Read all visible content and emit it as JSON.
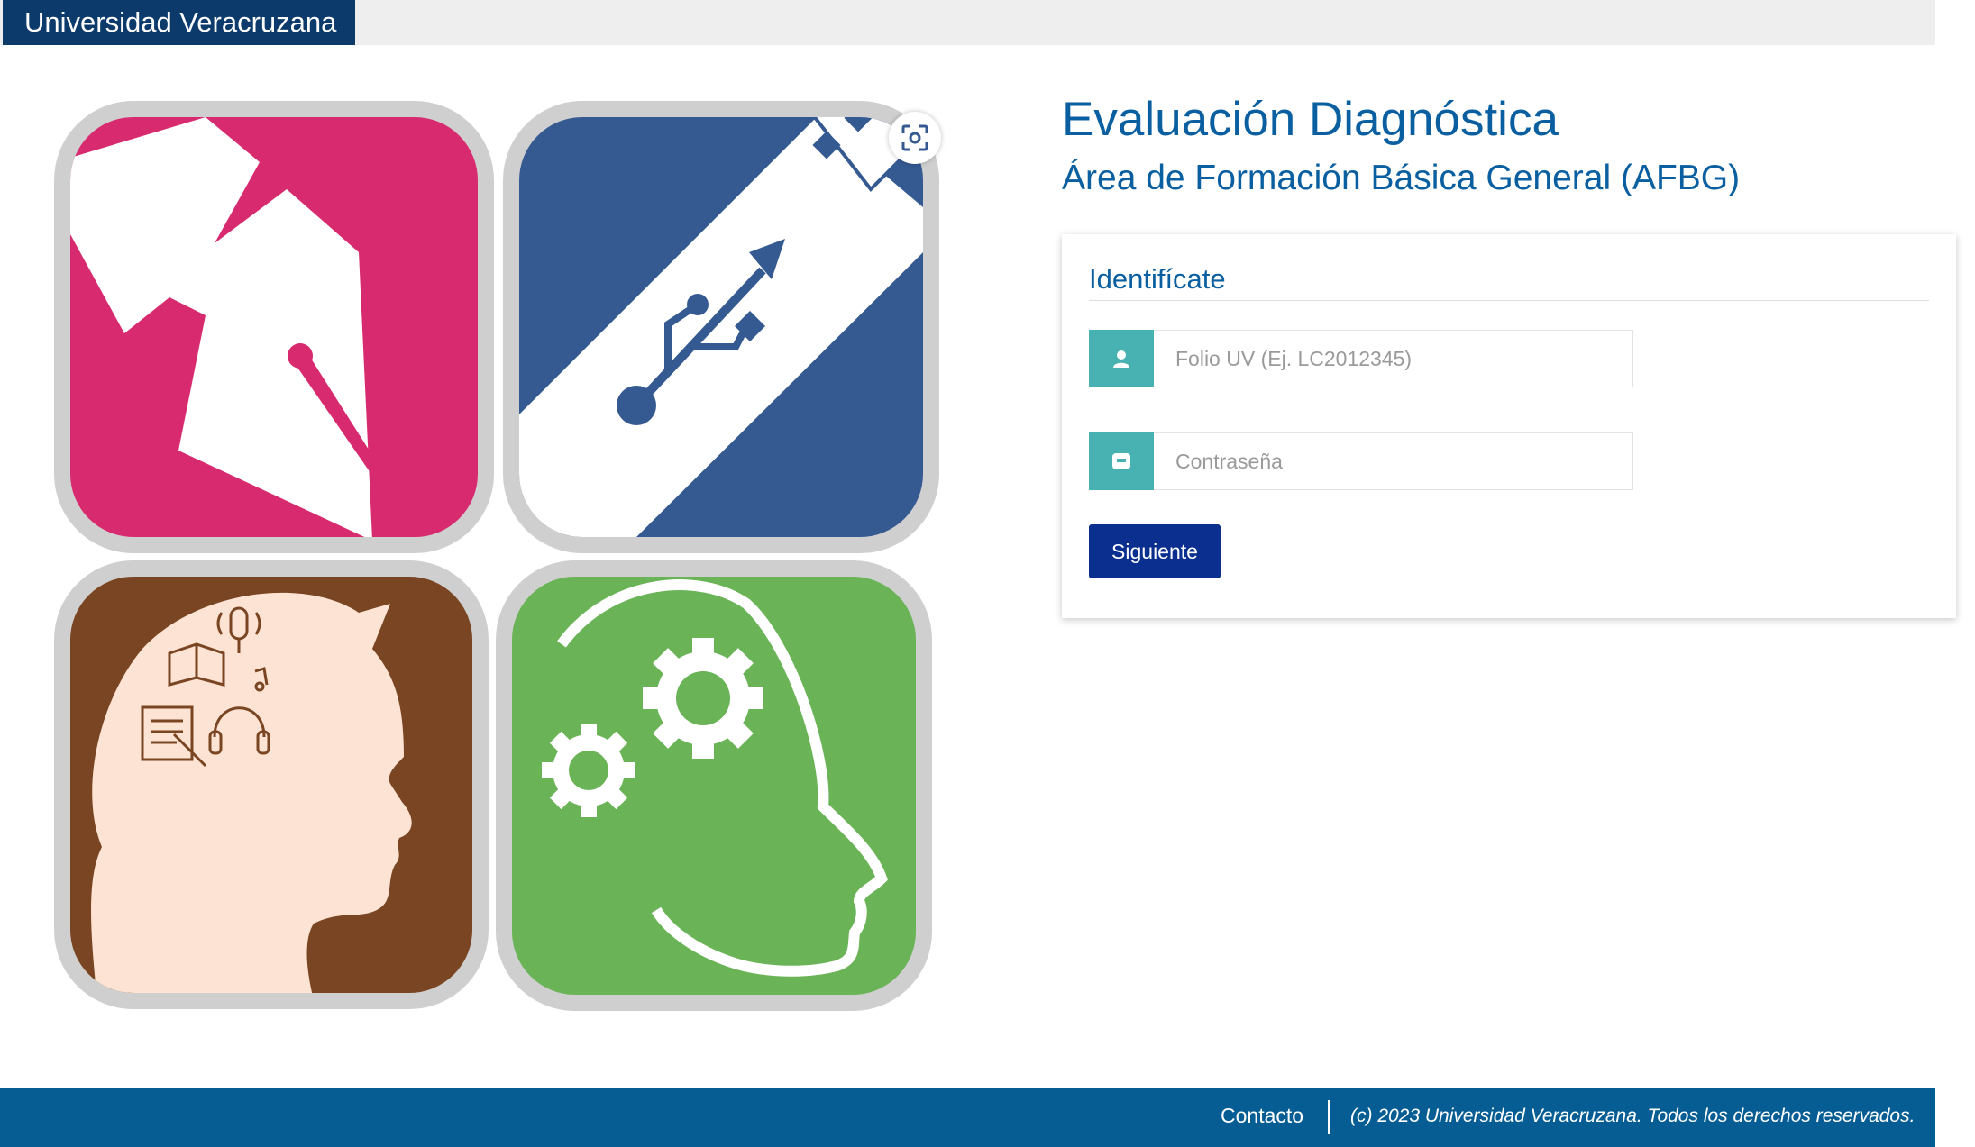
{
  "header": {
    "brand": "Universidad Veracruzana"
  },
  "main": {
    "title": "Evaluación Diagnóstica",
    "subtitle": "Área de Formación Básica General (AFBG)"
  },
  "login": {
    "heading": "Identifícate",
    "folio": {
      "placeholder": "Folio UV (Ej. LC2012345)",
      "value": "",
      "icon": "user-icon"
    },
    "password": {
      "placeholder": "Contraseña",
      "value": "",
      "icon": "lock-icon"
    },
    "submit_label": "Siguiente"
  },
  "tiles": [
    {
      "icon": "fountain-pen-icon",
      "color": "#d82b6f"
    },
    {
      "icon": "usb-drive-icon",
      "color": "#355a92"
    },
    {
      "icon": "head-learning-icon",
      "color": "#7a4522"
    },
    {
      "icon": "head-gears-icon",
      "color": "#6ab457"
    }
  ],
  "footer": {
    "contact": "Contacto",
    "copyright": "(c) 2023 Universidad Veracruzana. Todos los derechos reservados."
  },
  "colors": {
    "brand_navy": "#0b3a6b",
    "heading_blue": "#0a5fa0",
    "addon_teal": "#48b1b1",
    "button_blue": "#0b2f8e",
    "footer_blue": "#055d94"
  }
}
